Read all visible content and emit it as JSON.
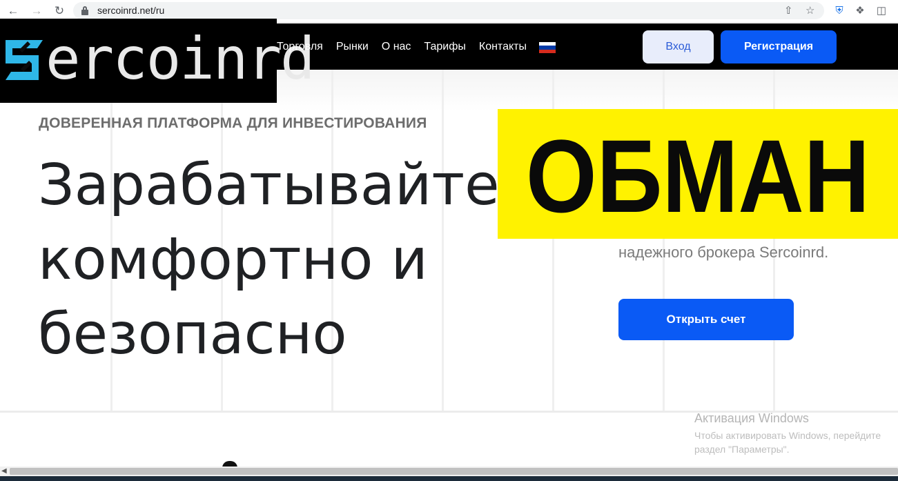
{
  "browser": {
    "url": "sercoinrd.net/ru"
  },
  "header": {
    "logo_text": "ercoinrd",
    "menu": [
      "Торговля",
      "Рынки",
      "О нас",
      "Тарифы",
      "Контакты"
    ],
    "login_label": "Вход",
    "register_label": "Регистрация"
  },
  "hero": {
    "eyebrow": "ДОВЕРЕННАЯ ПЛАТФОРМА ДЛЯ ИНВЕСТИРОВАНИЯ",
    "headline_lines": [
      "Зарабатывайте",
      "комфортно и",
      "безопасно"
    ],
    "subtext": "надежного брокера Sercoinrd.",
    "cta_label": "Открыть счет"
  },
  "overlay": {
    "stamp_text": "ОБМАН"
  },
  "windows_watermark": {
    "title": "Активация Windows",
    "line1": "Чтобы активировать Windows, перейдите",
    "line2": "раздел \"Параметры\"."
  },
  "colors": {
    "brand_blue": "#0a5af5",
    "stamp_yellow": "#fff200",
    "flag": [
      "#ffffff",
      "#0039a6",
      "#d52b1e"
    ]
  }
}
